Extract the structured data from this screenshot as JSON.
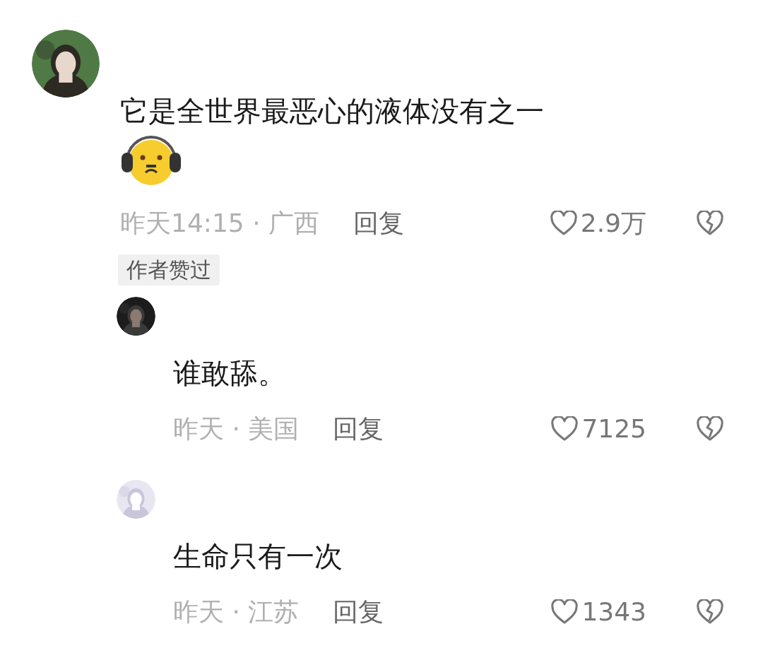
{
  "comment": {
    "text": "它是全世界最恶心的液体没有之一",
    "sticker": true,
    "time": "昨天14:15",
    "separator": "·",
    "place": "广西",
    "reply_label": "回复",
    "likes": "2.9万",
    "badge": "作者赞过",
    "replies": [
      {
        "text": "谁敢舔。",
        "time": "昨天",
        "separator": "·",
        "place": "美国",
        "reply_label": "回复",
        "likes": "7125"
      },
      {
        "text": "生命只有一次",
        "time": "昨天",
        "separator": "·",
        "place": "江苏",
        "reply_label": "回复",
        "likes": "1343"
      }
    ]
  }
}
